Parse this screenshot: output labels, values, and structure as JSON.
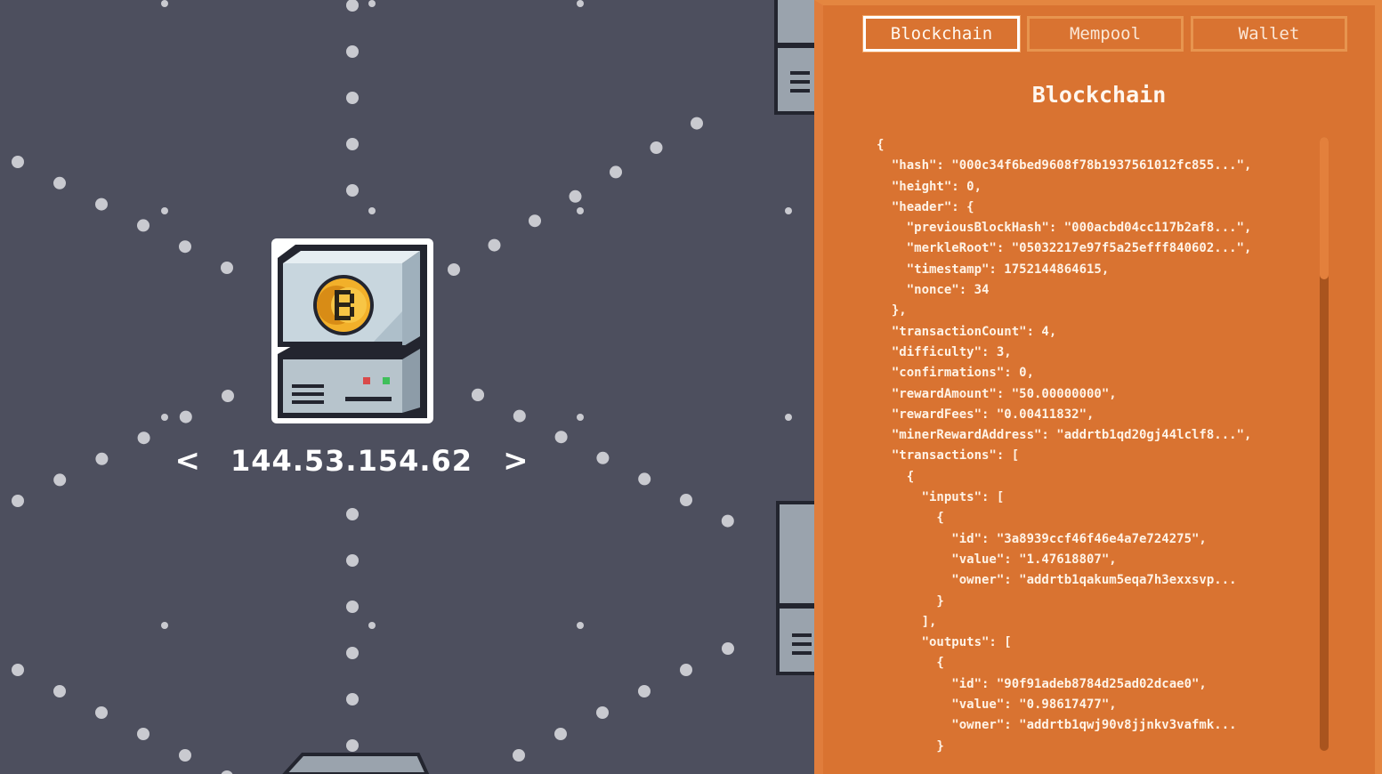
{
  "node": {
    "ip": "144.53.154.62",
    "prev_arrow": "<",
    "next_arrow": ">"
  },
  "tabs": [
    {
      "label": "Blockchain",
      "active": true
    },
    {
      "label": "Mempool",
      "active": false
    },
    {
      "label": "Wallet",
      "active": false
    }
  ],
  "panel": {
    "title": "Blockchain",
    "json_lines": [
      "{",
      "  \"hash\": \"000c34f6bed9608f78b1937561012fc855...\",",
      "  \"height\": 0,",
      "  \"header\": {",
      "    \"previousBlockHash\": \"000acbd04cc117b2af8...\",",
      "    \"merkleRoot\": \"05032217e97f5a25efff840602...\",",
      "    \"timestamp\": 1752144864615,",
      "    \"nonce\": 34",
      "  },",
      "  \"transactionCount\": 4,",
      "  \"difficulty\": 3,",
      "  \"confirmations\": 0,",
      "  \"rewardAmount\": \"50.00000000\",",
      "  \"rewardFees\": \"0.00411832\",",
      "  \"minerRewardAddress\": \"addrtb1qd20gj44lclf8...\",",
      "  \"transactions\": [",
      "    {",
      "      \"inputs\": [",
      "        {",
      "          \"id\": \"3a8939ccf46f46e4a7e724275\",",
      "          \"value\": \"1.47618807\",",
      "          \"owner\": \"addrtb1qakum5eqa7h3exxsvp...",
      "        }",
      "      ],",
      "      \"outputs\": [",
      "        {",
      "          \"id\": \"90f91adeb8784d25ad02dcae0\",",
      "          \"value\": \"0.98617477\",",
      "          \"owner\": \"addrtb1qwj90v8jjnkv3vafmk...",
      "        }"
    ]
  },
  "colors": {
    "background": "#4d4f5e",
    "panel": "#d97331",
    "dot": "#c9cad0",
    "coin": "#f2b02a"
  }
}
